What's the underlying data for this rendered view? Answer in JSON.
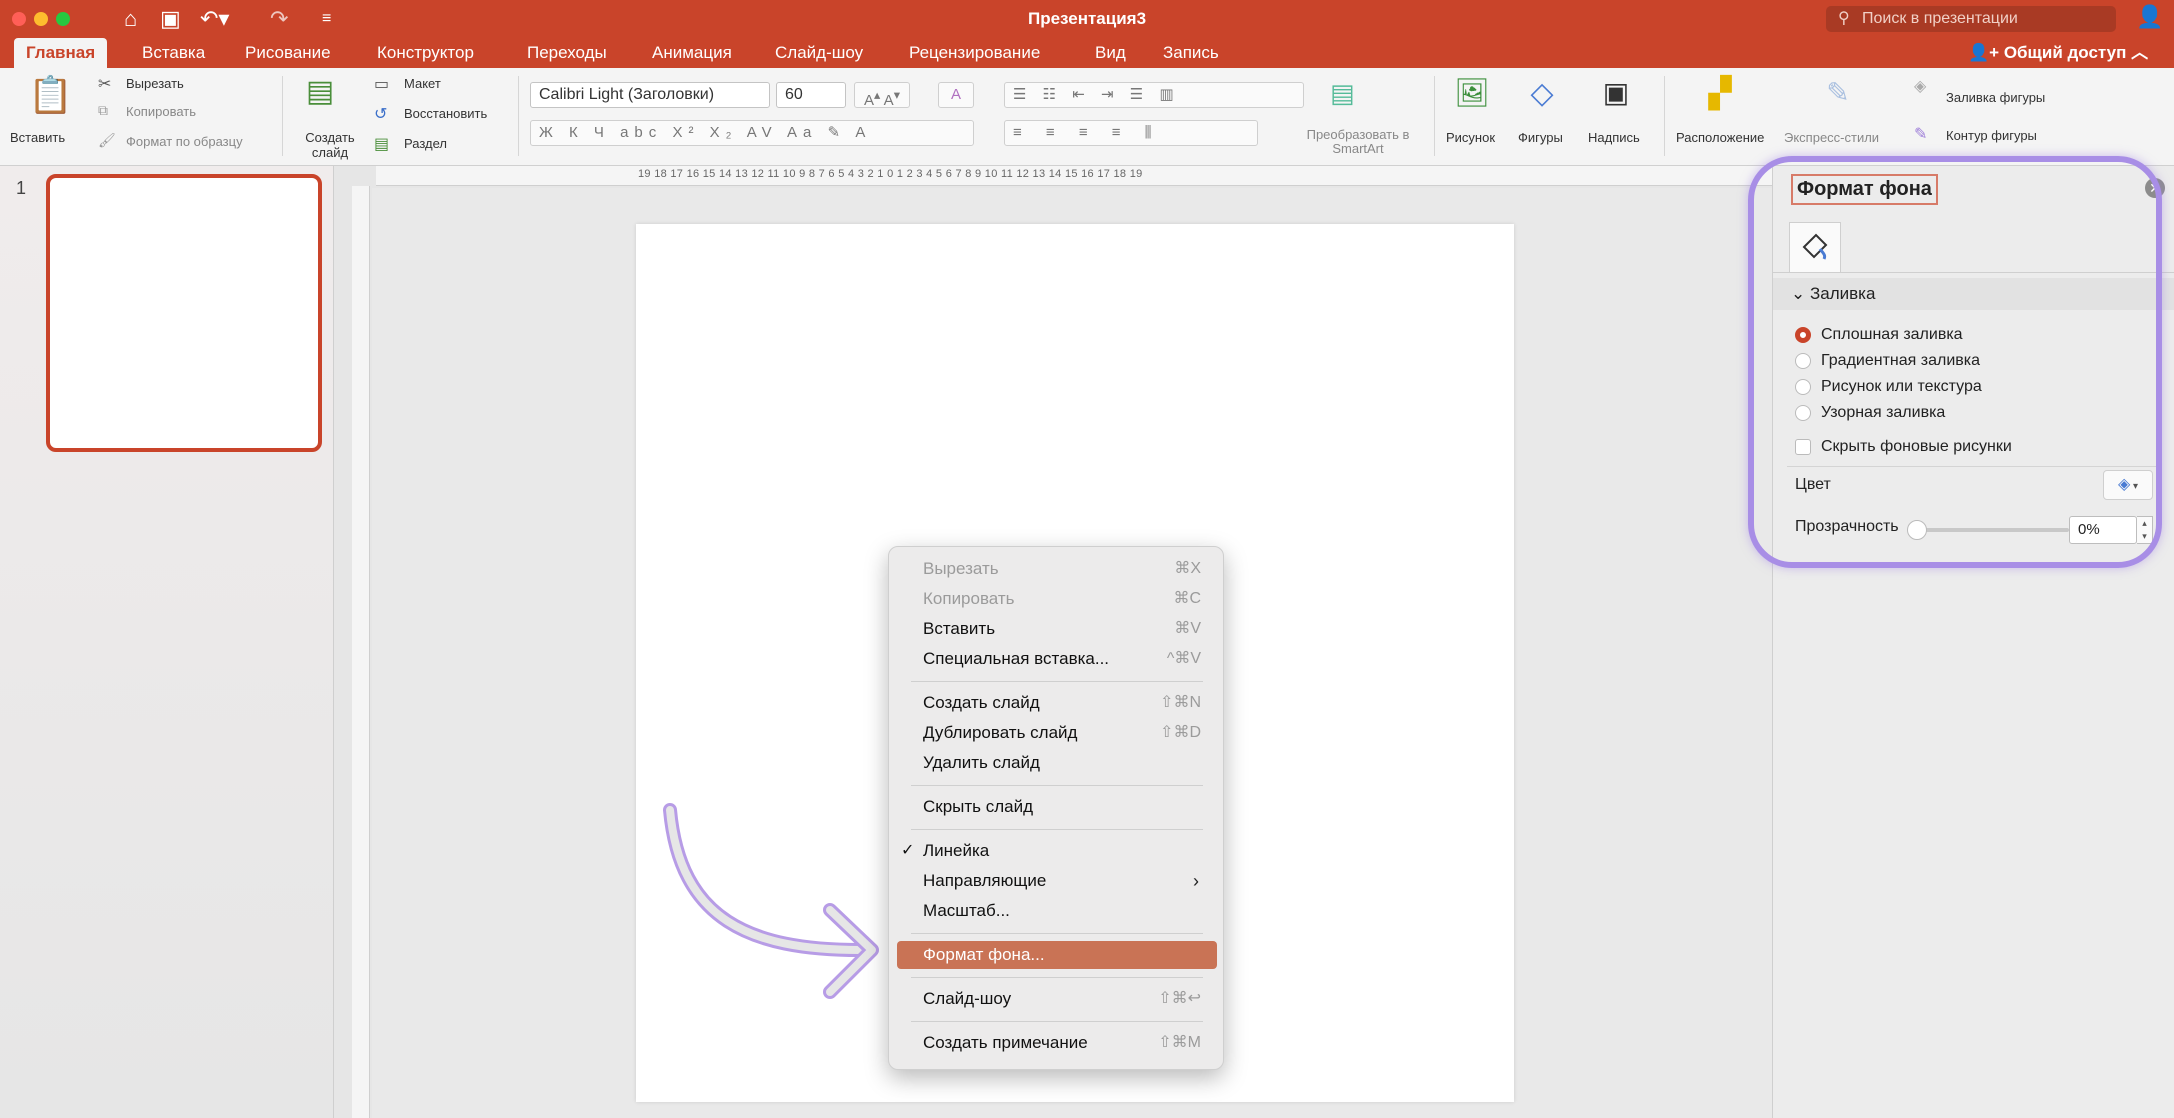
{
  "window": {
    "title": "Презентация3",
    "search_placeholder": "Поиск в презентации"
  },
  "tabs": [
    {
      "label": "Главная",
      "active": true
    },
    {
      "label": "Вставка"
    },
    {
      "label": "Рисование"
    },
    {
      "label": "Конструктор"
    },
    {
      "label": "Переходы"
    },
    {
      "label": "Анимация"
    },
    {
      "label": "Слайд-шоу"
    },
    {
      "label": "Рецензирование"
    },
    {
      "label": "Вид"
    },
    {
      "label": "Запись"
    }
  ],
  "share_label": "Общий доступ",
  "ribbon": {
    "paste": "Вставить",
    "cut": "Вырезать",
    "copy": "Копировать",
    "format_painter": "Формат по образцу",
    "new_slide": "Создать слайд",
    "layout": "Макет",
    "reset": "Восстановить",
    "section": "Раздел",
    "font_name": "Calibri Light (Заголовки)",
    "font_size": "60",
    "convert_smartart": "Преобразовать в SmartArt",
    "picture": "Рисунок",
    "shapes": "Фигуры",
    "textbox": "Надпись",
    "arrange": "Расположение",
    "quick_styles": "Экспресс-стили",
    "shape_fill": "Заливка фигуры",
    "shape_outline": "Контур фигуры"
  },
  "ruler": {
    "horizontal": "19 18 17 16 15 14 13 12 11 10 9 8 7 6 5 4 3 2 1 0 1 2 3 4 5 6 7 8 9 10 11 12 13 14 15 16 17 18 19"
  },
  "thumbnails": [
    {
      "number": "1"
    }
  ],
  "context_menu": [
    {
      "label": "Вырезать",
      "shortcut": "⌘X",
      "disabled": true
    },
    {
      "label": "Копировать",
      "shortcut": "⌘C",
      "disabled": true
    },
    {
      "label": "Вставить",
      "shortcut": "⌘V"
    },
    {
      "label": "Специальная вставка...",
      "shortcut": "^⌘V"
    },
    {
      "label": "Создать слайд",
      "shortcut": "⇧⌘N"
    },
    {
      "label": "Дублировать слайд",
      "shortcut": "⇧⌘D"
    },
    {
      "label": "Удалить слайд",
      "shortcut": ""
    },
    {
      "label": "Скрыть слайд",
      "shortcut": ""
    },
    {
      "label": "Линейка",
      "shortcut": "",
      "checked": true
    },
    {
      "label": "Направляющие",
      "shortcut": "",
      "submenu": true
    },
    {
      "label": "Масштаб...",
      "shortcut": ""
    },
    {
      "label": "Формат фона...",
      "shortcut": "",
      "selected": true
    },
    {
      "label": "Слайд-шоу",
      "shortcut": "⇧⌘↩"
    },
    {
      "label": "Создать примечание",
      "shortcut": "⇧⌘M"
    }
  ],
  "format_pane": {
    "title": "Формат фона",
    "section": "Заливка",
    "fill_options": [
      {
        "label": "Сплошная заливка",
        "selected": true
      },
      {
        "label": "Градиентная заливка"
      },
      {
        "label": "Рисунок или текстура"
      },
      {
        "label": "Узорная заливка"
      }
    ],
    "hide_bg": "Скрыть фоновые рисунки",
    "color_label": "Цвет",
    "transparency_label": "Прозрачность",
    "transparency_value": "0%"
  },
  "colors": {
    "accent": "#c9442a",
    "menu_highlight": "#c97355",
    "annotation": "#a88ee6"
  }
}
